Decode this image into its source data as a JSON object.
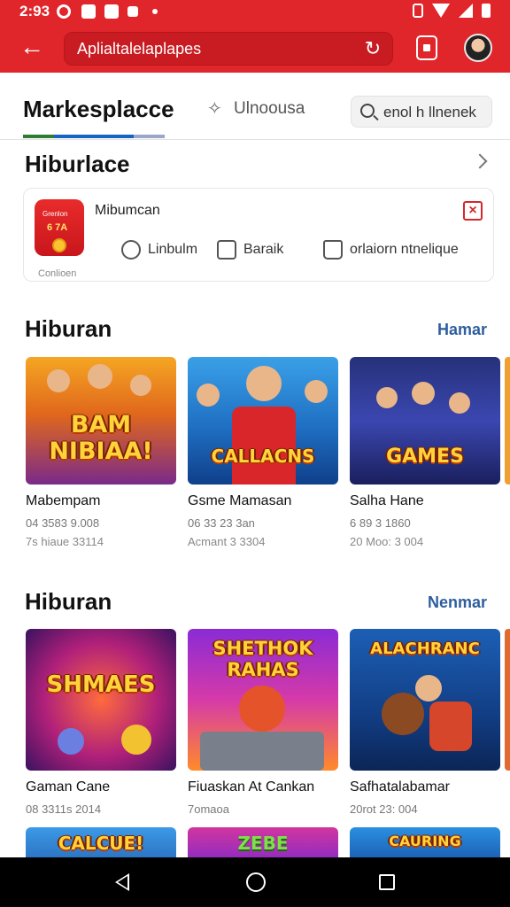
{
  "status_bar": {
    "time": "2:93"
  },
  "app_bar": {
    "url_text": "Aplialtalelaplapes"
  },
  "tabs": {
    "active": "Markesplacce",
    "other": "Ulnoousa",
    "search_label": "enol h llnenek"
  },
  "section_top": {
    "title": "Hiburlace"
  },
  "notice": {
    "icon_line1": "Grenlon",
    "icon_line2": "6 7A",
    "caption": "Conlioen",
    "title": "Mibumcan",
    "actions": [
      {
        "label": "Linbulm",
        "icon": "smile-icon"
      },
      {
        "label": "Baraik",
        "icon": "chat-icon"
      },
      {
        "label": "orlaiorn ntnelique",
        "icon": "bag-icon"
      }
    ]
  },
  "section_1": {
    "title": "Hiburan",
    "link": "Hamar",
    "tiles": [
      {
        "art": "BAM NIBIAA!",
        "badge": "",
        "name": "Mabempam",
        "meta": "04 3583 9.008",
        "meta2": "7s hiaue 33114"
      },
      {
        "art": "CALLACNS",
        "name": "Gsme Mamasan",
        "meta": "06 33 23 3an",
        "meta2": "Acmant 3 3304"
      },
      {
        "art": "GAMES",
        "name": "Salha Hane",
        "meta": "6 89 3 1860",
        "meta2": "20 Moo: 3 004"
      }
    ]
  },
  "section_2": {
    "title": "Hiburan",
    "link": "Nenmar",
    "tiles": [
      {
        "art": "SHMAES",
        "name": "Gaman Cane",
        "meta": "08 3311s 2014"
      },
      {
        "art": "SHETHOK RAHAS",
        "name": "Fiuaskan At Cankan",
        "meta": "7omaoa"
      },
      {
        "art": "ALACHRANC",
        "name": "Safhatalabamar",
        "meta": "20rot 23: 004"
      }
    ]
  },
  "section_3": {
    "tiles": [
      {
        "art": "CALCUE!"
      },
      {
        "art": "ZEBE"
      },
      {
        "art": "CAURING"
      }
    ]
  }
}
